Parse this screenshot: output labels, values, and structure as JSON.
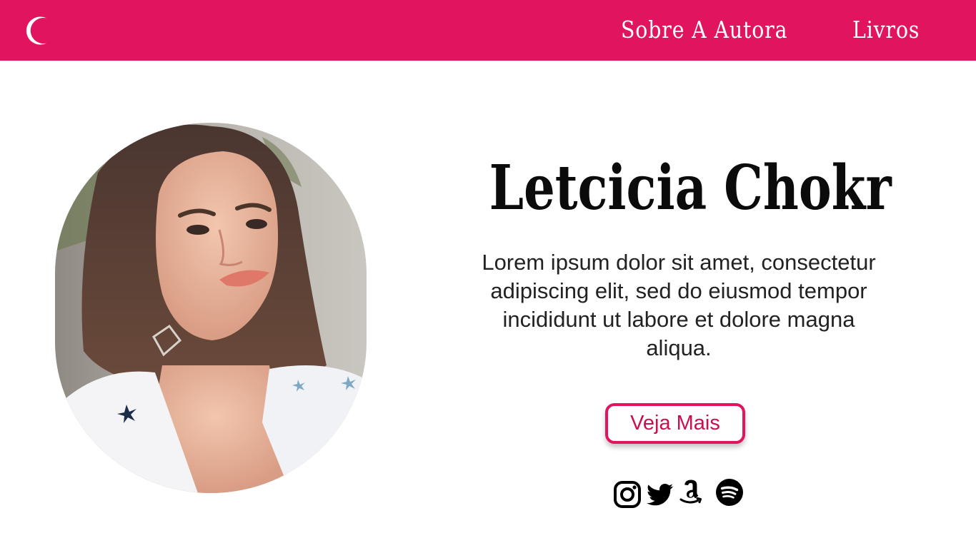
{
  "header": {
    "background": "#e0145f",
    "logo_icon": "crescent-moon-icon",
    "nav": [
      {
        "label": "Sobre A Autora"
      },
      {
        "label": "Livros"
      }
    ]
  },
  "hero": {
    "name": "Letcicia Chokr",
    "description": "Lorem ipsum dolor sit amet, consectetur adipiscing elit, sed do eiusmod tempor incididunt ut labore et dolore magna aliqua.",
    "cta_label": "Veja Mais",
    "accent": "#e0145f"
  },
  "socials": [
    {
      "icon": "instagram-icon"
    },
    {
      "icon": "twitter-icon"
    },
    {
      "icon": "amazon-icon"
    },
    {
      "icon": "spotify-icon"
    }
  ]
}
